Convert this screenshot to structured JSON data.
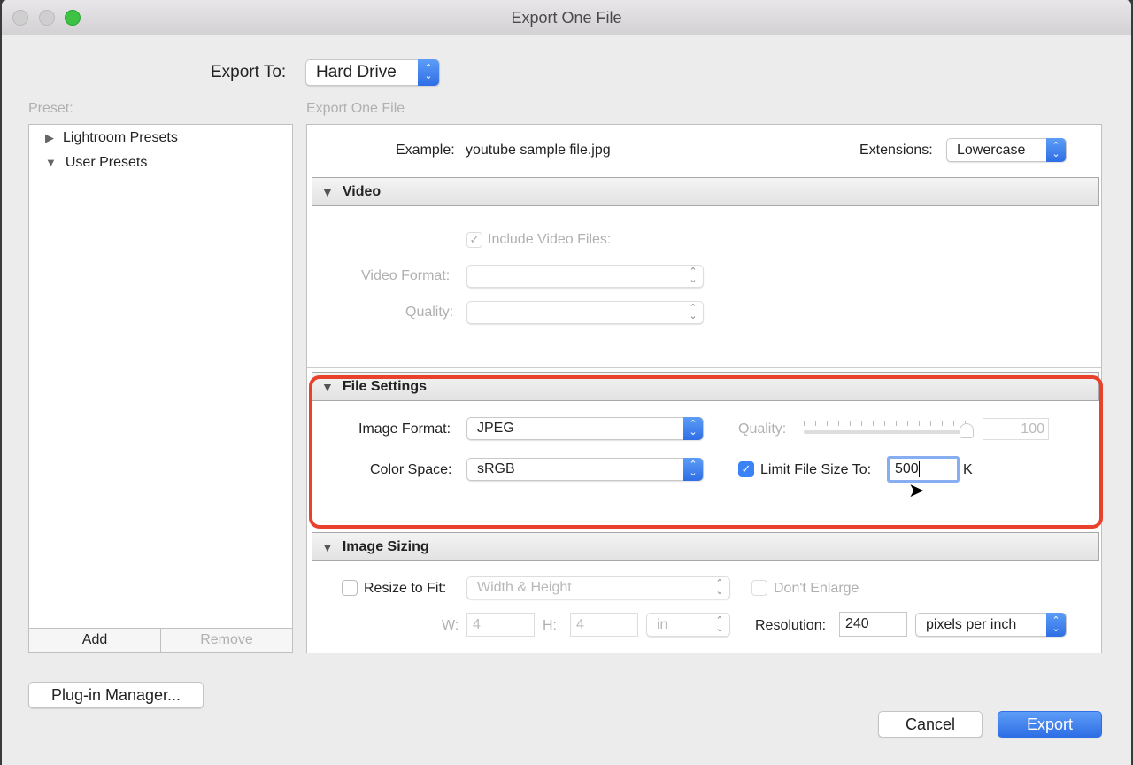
{
  "window": {
    "title": "Export One File"
  },
  "export_to": {
    "label": "Export To:",
    "value": "Hard Drive"
  },
  "preset": {
    "label": "Preset:",
    "items": [
      {
        "label": "Lightroom Presets",
        "expanded": false
      },
      {
        "label": "User Presets",
        "expanded": true
      }
    ],
    "add": "Add",
    "remove": "Remove"
  },
  "main": {
    "section_label": "Export One File",
    "example_label": "Example:",
    "example_value": "youtube sample file.jpg",
    "extensions_label": "Extensions:",
    "extensions_value": "Lowercase"
  },
  "video": {
    "title": "Video",
    "include_label": "Include Video Files:",
    "include_checked": true,
    "format_label": "Video Format:",
    "format_value": "",
    "quality_label": "Quality:",
    "quality_value": ""
  },
  "file_settings": {
    "title": "File Settings",
    "image_format_label": "Image Format:",
    "image_format_value": "JPEG",
    "color_space_label": "Color Space:",
    "color_space_value": "sRGB",
    "quality_label": "Quality:",
    "quality_value": "100",
    "quality_percent": 100,
    "limit_label": "Limit File Size To:",
    "limit_checked": true,
    "limit_value": "500",
    "limit_unit": "K",
    "highlight_color": "#e8412c"
  },
  "image_sizing": {
    "title": "Image Sizing",
    "resize_label": "Resize to Fit:",
    "resize_checked": false,
    "resize_value": "Width & Height",
    "dont_enlarge_label": "Don't Enlarge",
    "w_label": "W:",
    "w_value": "4",
    "h_label": "H:",
    "h_value": "4",
    "unit_value": "in",
    "resolution_label": "Resolution:",
    "resolution_value": "240",
    "resolution_unit": "pixels per inch"
  },
  "buttons": {
    "plugin_manager": "Plug-in Manager...",
    "cancel": "Cancel",
    "export": "Export"
  }
}
